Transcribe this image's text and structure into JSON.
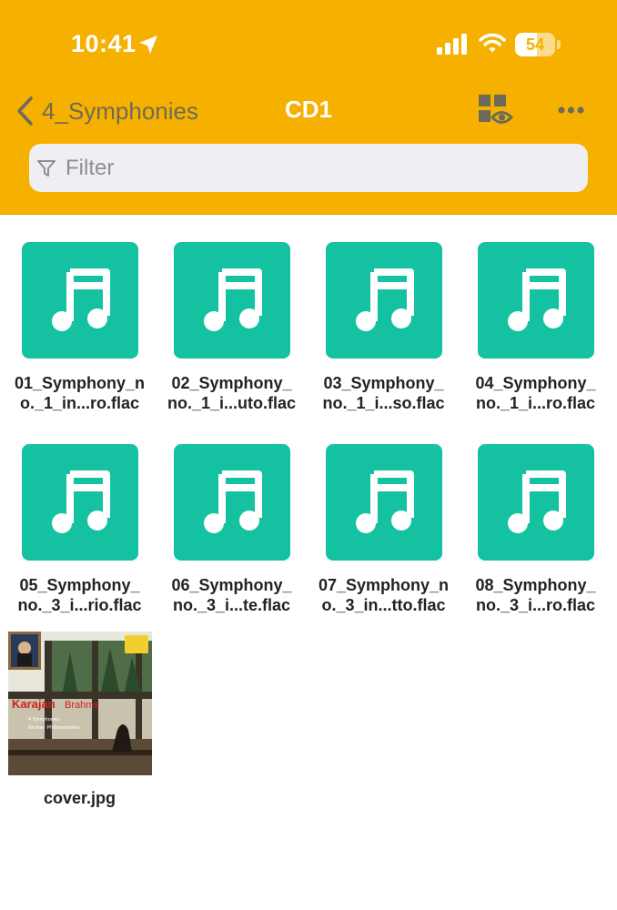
{
  "status_bar": {
    "time": "10:41",
    "battery": "54",
    "battery_level": 0.54
  },
  "nav": {
    "back_label": "4_Symphonies",
    "title": "CD1"
  },
  "filter": {
    "placeholder": "Filter",
    "value": ""
  },
  "files": [
    {
      "name": "01_Symphony_n\no._1_in...ro.flac",
      "kind": "audio"
    },
    {
      "name": "02_Symphony_\nno._1_i...uto.flac",
      "kind": "audio"
    },
    {
      "name": "03_Symphony_\nno._1_i...so.flac",
      "kind": "audio"
    },
    {
      "name": "04_Symphony_\nno._1_i...ro.flac",
      "kind": "audio"
    },
    {
      "name": "05_Symphony_\nno._3_i...rio.flac",
      "kind": "audio"
    },
    {
      "name": "06_Symphony_\nno._3_i...te.flac",
      "kind": "audio"
    },
    {
      "name": "07_Symphony_n\no._3_in...tto.flac",
      "kind": "audio"
    },
    {
      "name": "08_Symphony_\nno._3_i...ro.flac",
      "kind": "audio"
    },
    {
      "name": "cover.jpg",
      "kind": "image"
    }
  ],
  "cover_art": {
    "artist": "Karajan",
    "composer": "Brahms",
    "line1": "4 Symphonies",
    "line2": "Berliner Philharmoniker"
  },
  "colors": {
    "header": "#f6b100",
    "file_icon": "#14c2a2"
  }
}
